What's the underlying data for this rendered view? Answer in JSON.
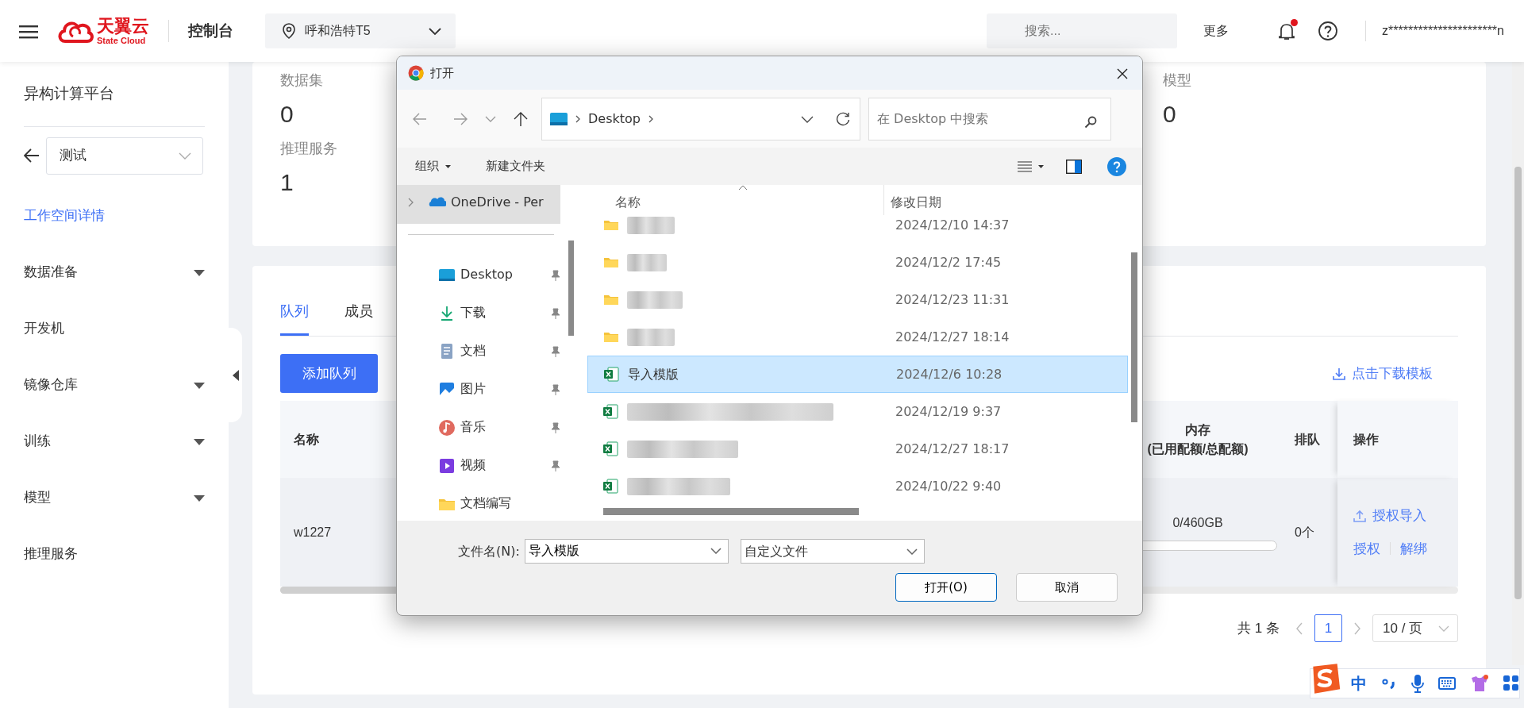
{
  "header": {
    "brand_name": "天翼云",
    "brand_sub": "State Cloud",
    "console": "控制台",
    "region": "呼和浩特T5",
    "search": {
      "placeholder": "搜索..."
    },
    "more": "更多",
    "notifications": {
      "unread": true
    },
    "user": "z**********************n"
  },
  "sidebar": {
    "title": "异构计算平台",
    "workspace": "测试",
    "items": [
      {
        "label": "工作空间详情",
        "selected": true,
        "expandable": false
      },
      {
        "label": "数据准备",
        "selected": false,
        "expandable": true
      },
      {
        "label": "开发机",
        "selected": false,
        "expandable": false
      },
      {
        "label": "镜像仓库",
        "selected": false,
        "expandable": true
      },
      {
        "label": "训练",
        "selected": false,
        "expandable": true
      },
      {
        "label": "模型",
        "selected": false,
        "expandable": true
      },
      {
        "label": "推理服务",
        "selected": false,
        "expandable": false
      }
    ]
  },
  "stats": [
    {
      "label": "数据集",
      "value": "0"
    },
    {
      "label": "推理服务",
      "value": "1"
    },
    {
      "label": "模型",
      "value": "0"
    }
  ],
  "tabs": [
    {
      "label": "队列",
      "selected": true
    },
    {
      "label": "成员",
      "selected": false
    }
  ],
  "add_button": "添加队列",
  "download_link": "点击下载模板",
  "table": {
    "columns": [
      {
        "label": "名称"
      },
      {
        "label": "内存",
        "sublabel": "(已用配额/总配额)"
      },
      {
        "label": "排队"
      },
      {
        "label": "操作"
      }
    ],
    "rows": [
      {
        "name": "w1227",
        "memory": {
          "reading": "0/460GB",
          "level": 0
        },
        "queued": "0个",
        "actions": [
          {
            "label": "授权导入",
            "kind": "upload"
          },
          {
            "label": "授权",
            "kind": "link"
          },
          {
            "label": "解绑",
            "kind": "link"
          }
        ]
      }
    ]
  },
  "pagination": {
    "total": "共 1 条",
    "pages": [
      {
        "label": "1",
        "selected": true
      }
    ],
    "page_size": "10 / 页"
  },
  "dialog": {
    "title": "打开",
    "path": "Desktop",
    "search": {
      "placeholder": "在 Desktop 中搜索"
    },
    "organize": "组织",
    "new_folder": "新建文件夹",
    "nav": [
      {
        "label": "OneDrive - Per",
        "kind": "cloud",
        "selected": true,
        "pinned": false
      },
      {
        "label": "Desktop",
        "kind": "desktop",
        "selected": false,
        "pinned": true
      },
      {
        "label": "下载",
        "kind": "download",
        "selected": false,
        "pinned": true
      },
      {
        "label": "文档",
        "kind": "document",
        "selected": false,
        "pinned": true
      },
      {
        "label": "图片",
        "kind": "image",
        "selected": false,
        "pinned": true
      },
      {
        "label": "音乐",
        "kind": "music",
        "selected": false,
        "pinned": true
      },
      {
        "label": "视频",
        "kind": "video",
        "selected": false,
        "pinned": true
      },
      {
        "label": "文档编写",
        "kind": "folder",
        "selected": false,
        "pinned": false
      }
    ],
    "columns": [
      "名称",
      "修改日期"
    ],
    "files": [
      {
        "kind": "folder",
        "date": "2024/12/10 14:37",
        "selected": false
      },
      {
        "kind": "folder",
        "date": "2024/12/2 17:45",
        "selected": false
      },
      {
        "kind": "folder",
        "date": "2024/12/23 11:31",
        "selected": false
      },
      {
        "kind": "folder",
        "date": "2024/12/27 18:14",
        "selected": false
      },
      {
        "kind": "excel",
        "name": "导入模版",
        "date": "2024/12/6 10:28",
        "selected": true
      },
      {
        "kind": "excel",
        "date": "2024/12/19 9:37",
        "selected": false
      },
      {
        "kind": "excel",
        "date": "2024/12/27 18:17",
        "selected": false
      },
      {
        "kind": "excel",
        "date": "2024/10/22 9:40",
        "selected": false
      }
    ],
    "filename": {
      "label": "文件名(N):",
      "value": "导入模版"
    },
    "filetype": "自定义文件",
    "buttons": [
      {
        "label": "打开(O)",
        "kind": "primary"
      },
      {
        "label": "取消",
        "kind": "secondary"
      }
    ]
  },
  "ime": {
    "mode": "中"
  }
}
